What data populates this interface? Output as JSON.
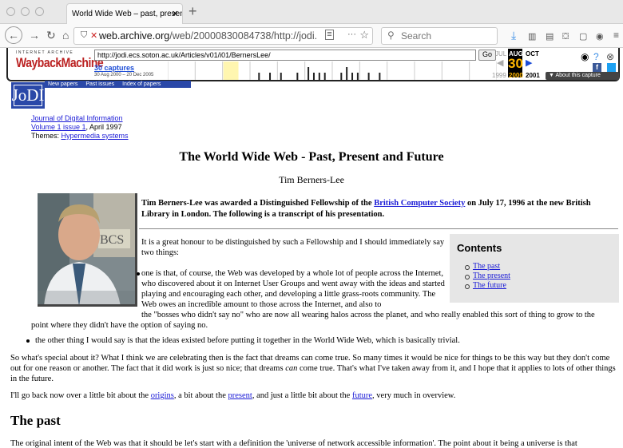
{
  "browser": {
    "tab_title": "World Wide Web – past, present an",
    "tab_close": "×",
    "new_tab": "+",
    "url_prefix": "web.archive.org",
    "url_rest": "/web/20000830084738/http://jodi.",
    "search_placeholder": "Search",
    "menu_dots": "···"
  },
  "wayback": {
    "ia_label": "INTERNET ARCHIVE",
    "logo": "WaybackMachine",
    "url_value": "http://jodi.ecs.soton.ac.uk/Articles/v01/i01/BernersLee/",
    "go_label": "Go",
    "captures": "30 captures",
    "range": "30 Aug 2000 – 20 Dec 2005",
    "months": {
      "prev": "JUL",
      "current": "AUG",
      "next": "OCT"
    },
    "day": "30",
    "years": {
      "prev": "1999",
      "current": "2000",
      "next": "2001"
    },
    "about": "▼ About this capture",
    "spark_values": [
      0,
      0,
      0,
      0,
      0,
      0,
      0,
      0,
      0,
      0,
      0,
      0,
      0,
      0,
      0,
      0,
      1,
      0,
      1,
      0,
      1,
      0,
      0,
      1,
      0,
      2,
      1,
      1,
      1,
      0,
      0,
      1,
      2,
      1,
      1,
      0,
      1,
      0,
      1,
      0,
      0,
      0,
      0,
      0,
      0,
      0,
      0,
      0,
      0,
      0,
      0,
      0,
      0,
      0,
      0,
      0,
      0,
      0,
      0,
      0
    ]
  },
  "site": {
    "logo_text": "JoDI",
    "nav": [
      "New papers",
      "Past issues",
      "Index of papers"
    ],
    "journal": "Journal of Digital Information",
    "volume": "Volume 1 issue 1",
    "date": ", April 1997",
    "themes_label": "Themes: ",
    "themes_link": "Hypermedia systems"
  },
  "article": {
    "title": "The World Wide Web - Past, Present and Future",
    "author": "Tim Berners-Lee",
    "intro_pre": "Tim Berners-Lee was awarded a Distinguished Fellowship of the ",
    "intro_link": "British Computer Society",
    "intro_post": " on July 17, 1996 at the new British Library in London. The following is a transcript of his presentation.",
    "p1": "It is a great honour to be distinguished by such a Fellowship and I should immediately say two things:",
    "b1_a": "one is that, of course, the Web was developed by a whole lot of people across the Internet, who discovered about it on Internet User Groups and went away with the ideas and started playing and encouraging each other, and developing a little grass-roots community. The Web owes an incredible amount to those across the Internet, and also to",
    "b1_b": "the \"bosses who didn't say no\" who are now all wearing halos across the planet, and who really enabled this sort of thing to grow to the",
    "b1_c": "point where they didn't have the option of saying no.",
    "b2": "the other thing I would say is that the ideas existed before putting it together in the World Wide Web, which is basically trivial.",
    "p2_a": "So what's special about it? What I think we are celebrating then is the fact that dreams can come true. So many times it would be nice for things to be this way but they don't come out for one reason or another. The fact that it did work is just so nice; that dreams ",
    "p2_em": "can",
    "p2_b": " come true. That's what I've taken away from it, and I hope that it applies to lots of other things in the future.",
    "p3_a": "I'll go back now over a little bit about the ",
    "p3_l1": "origins",
    "p3_b": ", a bit about the ",
    "p3_l2": "present",
    "p3_c": ", and just a little bit about the ",
    "p3_l3": "future",
    "p3_d": ", very much in overview.",
    "h_past": "The past",
    "p4": "The original intent of the Web was that it should be let's start with a definition the 'universe of network accessible information'. The point about it being a universe is that"
  },
  "contents": {
    "heading": "Contents",
    "items": [
      "The past",
      "The present",
      "The future"
    ]
  },
  "colors": {
    "accent": "#2a48a8",
    "link": "#1a1ad6",
    "wayback_red": "#b22222"
  }
}
